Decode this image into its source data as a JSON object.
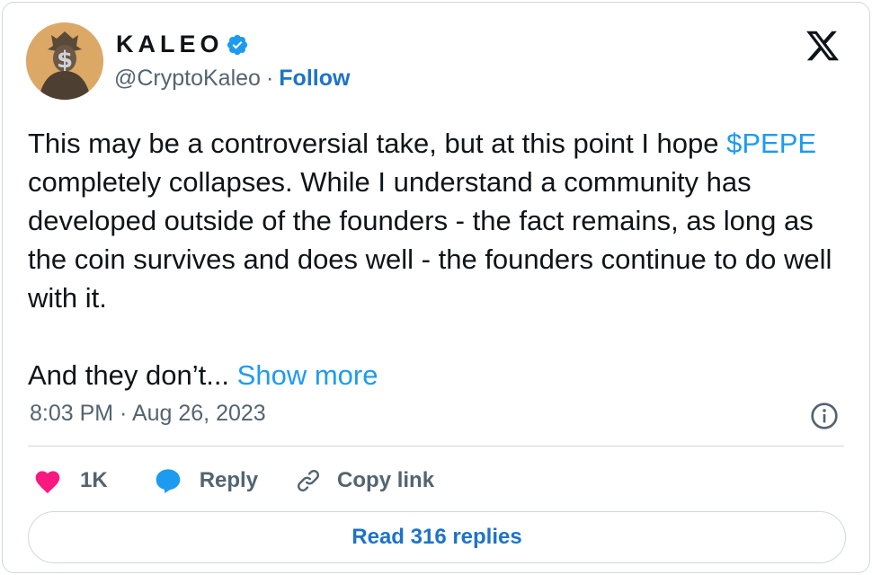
{
  "author": {
    "display_name": "KALEO",
    "handle": "@CryptoKaleo",
    "separator": "·",
    "follow_label": "Follow"
  },
  "tweet": {
    "line1_pre": "This may be a controversial take, but at this point I hope ",
    "cashtag": "$PEPE",
    "line1_post": " completely collapses. While I understand a community has developed outside of the founders - the fact remains, as long as the coin survives and does well - the founders continue to do well with it.",
    "para2": "And they don’t... ",
    "show_more": "Show more"
  },
  "timestamp": "8:03 PM · Aug 26, 2023",
  "actions": {
    "like_count": "1K",
    "reply_label": "Reply",
    "copy_label": "Copy link"
  },
  "read_replies_label": "Read 316 replies",
  "colors": {
    "link": "#1d9bf0",
    "follow": "#1d73c9",
    "like": "#f91880",
    "verified": "#1d9bf0"
  }
}
